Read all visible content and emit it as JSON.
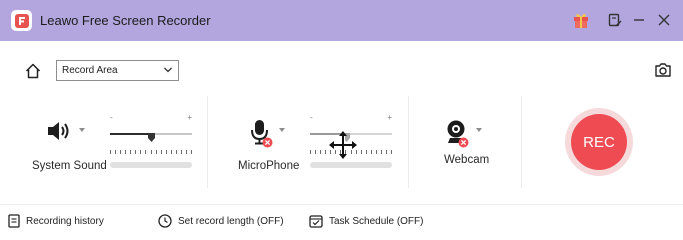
{
  "window": {
    "title": "Leawo Free Screen Recorder",
    "title_bar_color": "#b3a6df"
  },
  "toolbar": {
    "record_area_value": "Record Area"
  },
  "system_sound": {
    "label": "System Sound",
    "slider_min_label": "-",
    "slider_max_label": "+",
    "volume_fraction": 0.5
  },
  "microphone": {
    "label": "MicroPhone",
    "muted": true,
    "slider_min_label": "-",
    "slider_max_label": "+",
    "volume_fraction": 0.45
  },
  "webcam": {
    "label": "Webcam",
    "muted": true
  },
  "rec_button": {
    "label": "REC",
    "color": "#ef4b53"
  },
  "bottom_bar": {
    "recording_history": "Recording history",
    "set_record_length": "Set record length (OFF)",
    "task_schedule": "Task Schedule (OFF)"
  },
  "icons": [
    "app-logo-icon",
    "gift-icon",
    "edit-icon",
    "minimize-icon",
    "close-icon",
    "home-icon",
    "chevron-down-icon",
    "camera-icon",
    "speaker-icon",
    "microphone-icon",
    "webcam-icon",
    "muted-badge-icon",
    "move-cursor-icon",
    "document-icon",
    "clock-icon",
    "calendar-icon"
  ]
}
